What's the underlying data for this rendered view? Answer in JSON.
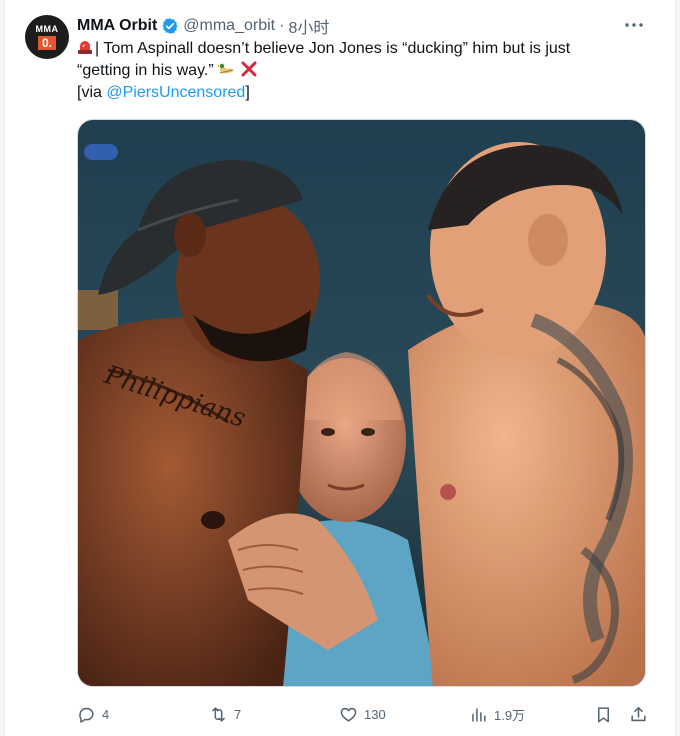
{
  "tweet": {
    "author_name": "MMA Orbit",
    "handle": "@mma_orbit",
    "separator": "·",
    "time": "8小时",
    "avatar_top": "MMA",
    "avatar_bottom": "0.",
    "text_line1": "| Tom Aspinall doesn’t believe Jon Jones is “ducking” him but is just",
    "text_line2": "“getting in his way.”",
    "via_prefix": "[via ",
    "via_link": "@PiersUncensored",
    "via_suffix": "]",
    "image_tattoo_text": "Philippians"
  },
  "actions": {
    "replies": "4",
    "reposts": "7",
    "likes": "130",
    "views": "1.9万"
  },
  "icons": {
    "more": "more-icon",
    "verified": "verified-badge-icon",
    "siren": "siren-emoji-icon",
    "duck": "duck-emoji-icon",
    "cross": "cross-mark-emoji-icon",
    "reply": "reply-icon",
    "repost": "repost-icon",
    "like": "heart-icon",
    "views": "views-icon",
    "bookmark": "bookmark-icon",
    "share": "share-icon"
  },
  "colors": {
    "link": "#1d9bf0",
    "verified": "#1d9bf0",
    "text": "#0f1419",
    "muted": "#536471"
  }
}
